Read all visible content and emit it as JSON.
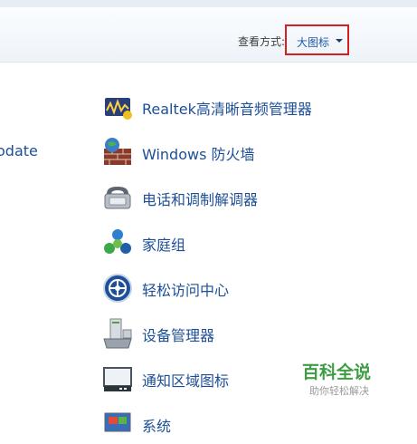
{
  "header": {
    "view_by_label": "查看方式:",
    "view_by_value": "大图标"
  },
  "left_partial_item": "odate",
  "items": [
    {
      "label": "Realtek高清晰音频管理器",
      "icon": "realtek-audio-icon"
    },
    {
      "label": "Windows 防火墙",
      "icon": "firewall-icon"
    },
    {
      "label": "电话和调制解调器",
      "icon": "phone-modem-icon"
    },
    {
      "label": "家庭组",
      "icon": "homegroup-icon"
    },
    {
      "label": "轻松访问中心",
      "icon": "ease-of-access-icon"
    },
    {
      "label": "设备管理器",
      "icon": "device-manager-icon"
    },
    {
      "label": "通知区域图标",
      "icon": "notification-area-icon"
    },
    {
      "label": "系统",
      "icon": "system-icon"
    }
  ],
  "watermark": {
    "main": "百科全说",
    "sub": "助你轻松解决"
  },
  "colors": {
    "link": "#1d4f96",
    "highlight_box": "#d62020",
    "watermark_green": "#3e9d43"
  }
}
